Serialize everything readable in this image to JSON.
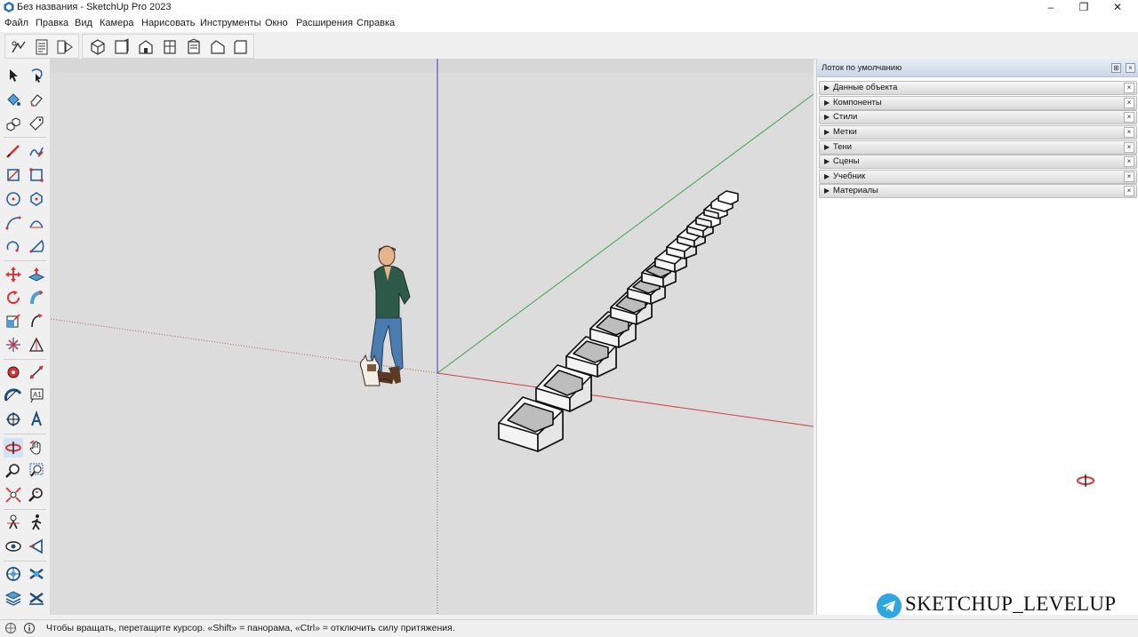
{
  "window": {
    "title": "Без названия - SketchUp Pro 2023",
    "controls": [
      "–",
      "❐",
      "✕"
    ]
  },
  "menu": [
    "Файл",
    "Правка",
    "Вид",
    "Камера",
    "Нарисовать",
    "Инструменты",
    "Окно",
    "Расширения",
    "Справка"
  ],
  "toolbar": {
    "group1": [
      "model-info-icon",
      "entity-list-icon",
      "outliner-icon"
    ],
    "group2": [
      "iso-view-icon",
      "top-view-icon",
      "front-view-icon",
      "right-view-icon",
      "back-view-icon",
      "left-view-icon",
      "bottom-view-icon"
    ]
  },
  "tray": {
    "title": "Лоток по умолчанию",
    "pin": "⊞",
    "close": "×",
    "panels": [
      "Данные объекта",
      "Компоненты",
      "Стили",
      "Метки",
      "Тени",
      "Сцены",
      "Учебник",
      "Материалы"
    ],
    "panel_close": "×",
    "panel_arrow": "▶"
  },
  "status": {
    "text": "Чтобы вращать, перетащите курсор. «Shift» = панорама, «Ctrl» = отключить силу притяжения."
  },
  "watermark": {
    "text": "SKETCHUP_LEVELUP"
  },
  "active_tool": "orbit",
  "colors": {
    "axis_red": "#d04040",
    "axis_green": "#3fa34a",
    "axis_blue": "#3a3ad0",
    "viewport_bg": "#dcdcdc",
    "telegram": "#2ea6e0"
  }
}
